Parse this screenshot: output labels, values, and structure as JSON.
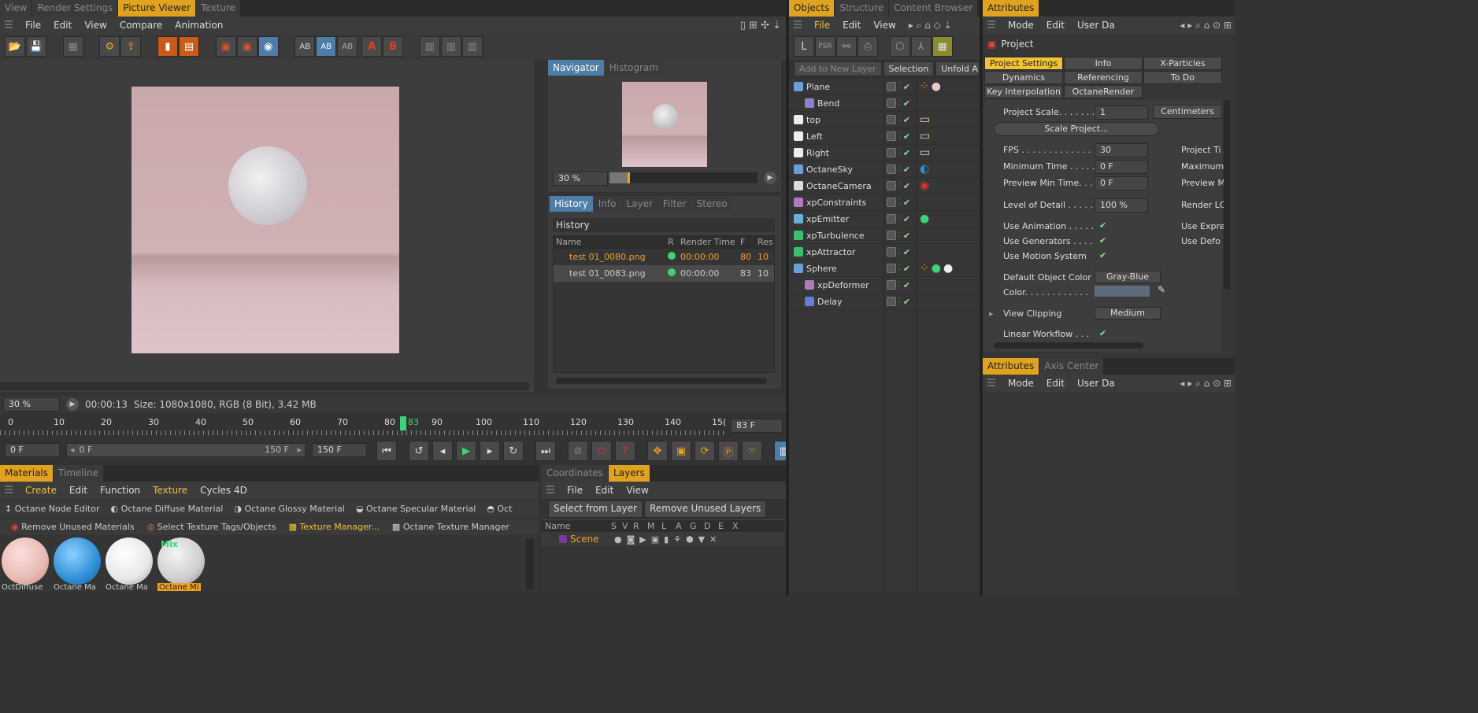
{
  "left_tabs": [
    "View",
    "Render Settings",
    "Picture Viewer",
    "Texture"
  ],
  "left_tabs_active": 2,
  "pv_menu": [
    "File",
    "Edit",
    "View",
    "Compare",
    "Animation"
  ],
  "toolbar_icons": [
    "open-icon",
    "save-icon",
    "grid-icon",
    "hierarchy-icon",
    "export-icon",
    "delete-icon",
    "duplicate-icon",
    "render-region-icon",
    "render-view-icon",
    "render-pv-icon",
    "ab-a-icon",
    "ab-b-icon",
    "ab-ab-icon",
    "a-marker-icon",
    "b-marker-icon",
    "layout-1-icon",
    "layout-2-icon",
    "layout-3-icon"
  ],
  "navigator": {
    "tabs": [
      "Navigator",
      "Histogram"
    ],
    "zoom": "30 %"
  },
  "history": {
    "tabs": [
      "History",
      "Info",
      "Layer",
      "Filter",
      "Stereo"
    ],
    "title": "History",
    "columns": [
      "Name",
      "R",
      "Render Time",
      "F",
      "Res"
    ],
    "rows": [
      {
        "name": "test 01_0080.png",
        "time": "00:00:00",
        "f": "80",
        "res": "10"
      },
      {
        "name": "test 01_0083.png",
        "time": "00:00:00",
        "f": "83",
        "res": "10"
      }
    ]
  },
  "status": {
    "zoom": "30 %",
    "time": "00:00:13",
    "size": "Size: 1080x1080, RGB (8 Bit), 3.42 MB"
  },
  "timeline": {
    "ticks": [
      "0",
      "10",
      "20",
      "30",
      "40",
      "50",
      "60",
      "70",
      "80",
      "90",
      "100",
      "110",
      "120",
      "130",
      "140",
      "15("
    ],
    "current": "83",
    "frame_field": "83 F",
    "start": "0 F",
    "range_start": "0 F",
    "range_end": "150 F",
    "end": "150 F"
  },
  "materials": {
    "tabs": [
      "Materials",
      "Timeline"
    ],
    "menu": [
      "Create",
      "Edit",
      "Function",
      "Texture",
      "Cycles 4D"
    ],
    "octane_items": [
      "Octane Node Editor",
      "Octane Diffuse Material",
      "Octane Glossy Material",
      "Octane Specular Material",
      "Oct"
    ],
    "bottom_items": [
      "Remove Unused Materials",
      "Select Texture Tags/Objects",
      "Texture Manager...",
      "Octane Texture Manager"
    ],
    "thumbs": [
      {
        "label": "OctDiffuse",
        "color": "#e9b8b4"
      },
      {
        "label": "Octane Ma",
        "color": "#2f8fd6"
      },
      {
        "label": "Octane Ma",
        "color": "#eeeeee"
      },
      {
        "label": "Octane Mi",
        "color": "#cfcfcf",
        "mix": "Mix"
      }
    ]
  },
  "layers": {
    "tabs": [
      "Coordinates",
      "Layers"
    ],
    "menu": [
      "File",
      "Edit",
      "View"
    ],
    "buttons": [
      "Select from Layer",
      "Remove Unused Layers"
    ],
    "columns": [
      "Name",
      "S",
      "V",
      "R",
      "M",
      "L",
      "A",
      "G",
      "D",
      "E",
      "X"
    ],
    "scene": "Scene"
  },
  "objects": {
    "tabs": [
      "Objects",
      "Structure",
      "Content Browser"
    ],
    "menu": [
      "File",
      "Edit",
      "View"
    ],
    "layer_buttons": [
      "Add to New Layer",
      "Selection",
      "Unfold Al"
    ],
    "items": [
      {
        "name": "Plane",
        "indent": 0,
        "icon": "plane-icon",
        "color": "#6aa0d8",
        "tags": [
          "dots",
          "ball"
        ]
      },
      {
        "name": "Bend",
        "indent": 1,
        "icon": "bend-icon",
        "color": "#8a80d0",
        "tags": []
      },
      {
        "name": "top",
        "indent": 0,
        "icon": "light-icon",
        "color": "#eeeeee",
        "tags": [
          "light-tag"
        ]
      },
      {
        "name": "Left",
        "indent": 0,
        "icon": "light-icon",
        "color": "#eeeeee",
        "tags": [
          "light-tag"
        ]
      },
      {
        "name": "Right",
        "indent": 0,
        "icon": "light-icon",
        "color": "#eeeeee",
        "tags": [
          "light-tag"
        ]
      },
      {
        "name": "OctaneSky",
        "indent": 0,
        "icon": "sky-icon",
        "color": "#6aa0d8",
        "tags": [
          "sky-tag"
        ]
      },
      {
        "name": "OctaneCamera",
        "indent": 0,
        "icon": "camera-icon",
        "color": "#dddddd",
        "tags": [
          "cam-tag"
        ]
      },
      {
        "name": "xpConstraints",
        "indent": 0,
        "icon": "constraints-icon",
        "color": "#b07ac0",
        "tags": []
      },
      {
        "name": "xpEmitter",
        "indent": 0,
        "icon": "emitter-icon",
        "color": "#6ab0d8",
        "tags": [
          "green-tag"
        ]
      },
      {
        "name": "xpTurbulence",
        "indent": 0,
        "icon": "turbulence-icon",
        "color": "#3ac070",
        "tags": []
      },
      {
        "name": "xpAttractor",
        "indent": 0,
        "icon": "attractor-icon",
        "color": "#3ac070",
        "tags": []
      },
      {
        "name": "Sphere",
        "indent": 0,
        "icon": "sphere-icon",
        "color": "#6aa0d8",
        "tags": [
          "dots",
          "green-tag",
          "ball2"
        ]
      },
      {
        "name": "xpDeformer",
        "indent": 1,
        "icon": "deformer-icon",
        "color": "#b07ac0",
        "tags": []
      },
      {
        "name": "Delay",
        "indent": 1,
        "icon": "delay-icon",
        "color": "#6a7ad8",
        "tags": []
      }
    ]
  },
  "attributes": {
    "tab": "Attributes",
    "menu": [
      "Mode",
      "Edit",
      "User Da"
    ],
    "title": "Project",
    "tabs_row1": [
      "Project Settings",
      "Info",
      "X-Particles"
    ],
    "tabs_row2": [
      "Dynamics",
      "Referencing",
      "To Do"
    ],
    "tabs_row3": [
      "Key Interpolation",
      "OctaneRender"
    ],
    "project_scale_label": "Project Scale. . . . . . .",
    "project_scale": "1",
    "unit": "Centimeters",
    "scale_button": "Scale Project...",
    "fields": [
      {
        "label": "FPS . . . . . . . . . . . . .",
        "value": "30",
        "right": "Project Ti"
      },
      {
        "label": "Minimum Time . . . . .",
        "value": "0 F",
        "right": "Maximum"
      },
      {
        "label": "Preview Min Time. . .",
        "value": "0 F",
        "right": "Preview M"
      }
    ],
    "lod_label": "Level of Detail . . . . .",
    "lod": "100 %",
    "lod_right": "Render LC",
    "checks": [
      {
        "label": "Use Animation . . . . .",
        "right": "Use Expre"
      },
      {
        "label": "Use Generators . . . .",
        "right": "Use Defo"
      },
      {
        "label": "Use Motion System",
        "right": ""
      }
    ],
    "default_color_label": "Default Object Color",
    "default_color": "Gray-Blue",
    "color_label": "Color. . . . . . . . . . . .",
    "view_clipping_label": "View Clipping",
    "view_clipping": "Medium",
    "linear_label": "Linear Workflow . . .",
    "lower_tabs": [
      "Attributes",
      "Axis Center"
    ],
    "lower_menu": [
      "Mode",
      "Edit",
      "User Da"
    ]
  }
}
